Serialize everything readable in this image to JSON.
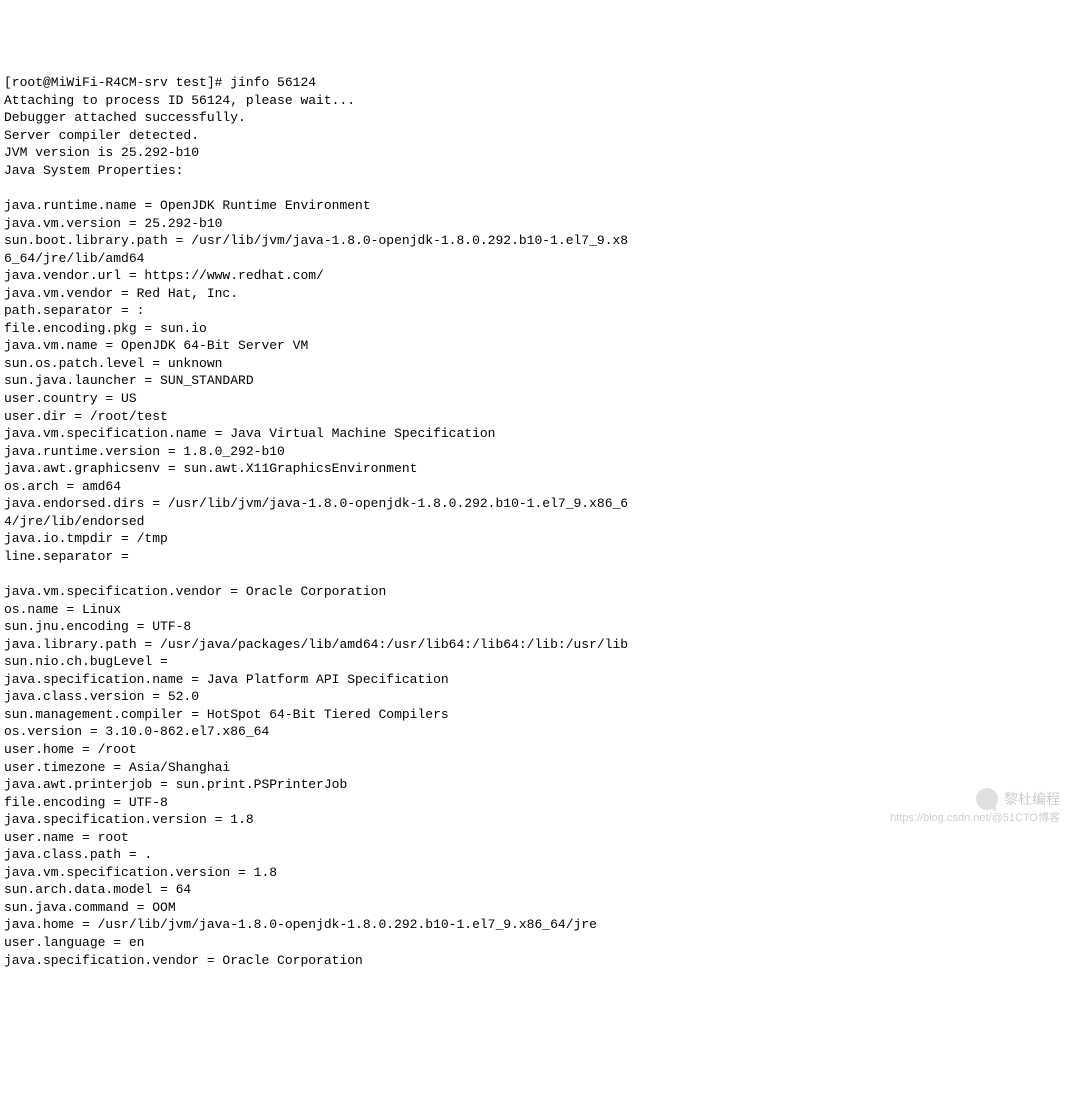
{
  "terminal": {
    "lines": [
      "[root@MiWiFi-R4CM-srv test]# jinfo 56124",
      "Attaching to process ID 56124, please wait...",
      "Debugger attached successfully.",
      "Server compiler detected.",
      "JVM version is 25.292-b10",
      "Java System Properties:",
      "",
      "java.runtime.name = OpenJDK Runtime Environment",
      "java.vm.version = 25.292-b10",
      "sun.boot.library.path = /usr/lib/jvm/java-1.8.0-openjdk-1.8.0.292.b10-1.el7_9.x8",
      "6_64/jre/lib/amd64",
      "java.vendor.url = https://www.redhat.com/",
      "java.vm.vendor = Red Hat, Inc.",
      "path.separator = :",
      "file.encoding.pkg = sun.io",
      "java.vm.name = OpenJDK 64-Bit Server VM",
      "sun.os.patch.level = unknown",
      "sun.java.launcher = SUN_STANDARD",
      "user.country = US",
      "user.dir = /root/test",
      "java.vm.specification.name = Java Virtual Machine Specification",
      "java.runtime.version = 1.8.0_292-b10",
      "java.awt.graphicsenv = sun.awt.X11GraphicsEnvironment",
      "os.arch = amd64",
      "java.endorsed.dirs = /usr/lib/jvm/java-1.8.0-openjdk-1.8.0.292.b10-1.el7_9.x86_6",
      "4/jre/lib/endorsed",
      "java.io.tmpdir = /tmp",
      "line.separator =",
      "",
      "java.vm.specification.vendor = Oracle Corporation",
      "os.name = Linux",
      "sun.jnu.encoding = UTF-8",
      "java.library.path = /usr/java/packages/lib/amd64:/usr/lib64:/lib64:/lib:/usr/lib",
      "sun.nio.ch.bugLevel =",
      "java.specification.name = Java Platform API Specification",
      "java.class.version = 52.0",
      "sun.management.compiler = HotSpot 64-Bit Tiered Compilers",
      "os.version = 3.10.0-862.el7.x86_64",
      "user.home = /root",
      "user.timezone = Asia/Shanghai",
      "java.awt.printerjob = sun.print.PSPrinterJob",
      "file.encoding = UTF-8",
      "java.specification.version = 1.8",
      "user.name = root",
      "java.class.path = .",
      "java.vm.specification.version = 1.8",
      "sun.arch.data.model = 64",
      "sun.java.command = OOM",
      "java.home = /usr/lib/jvm/java-1.8.0-openjdk-1.8.0.292.b10-1.el7_9.x86_64/jre",
      "user.language = en",
      "java.specification.vendor = Oracle Corporation"
    ]
  },
  "watermark": {
    "main": "黎杜编程",
    "sub": "https://blog.csdn.net/@51CTO博客"
  }
}
